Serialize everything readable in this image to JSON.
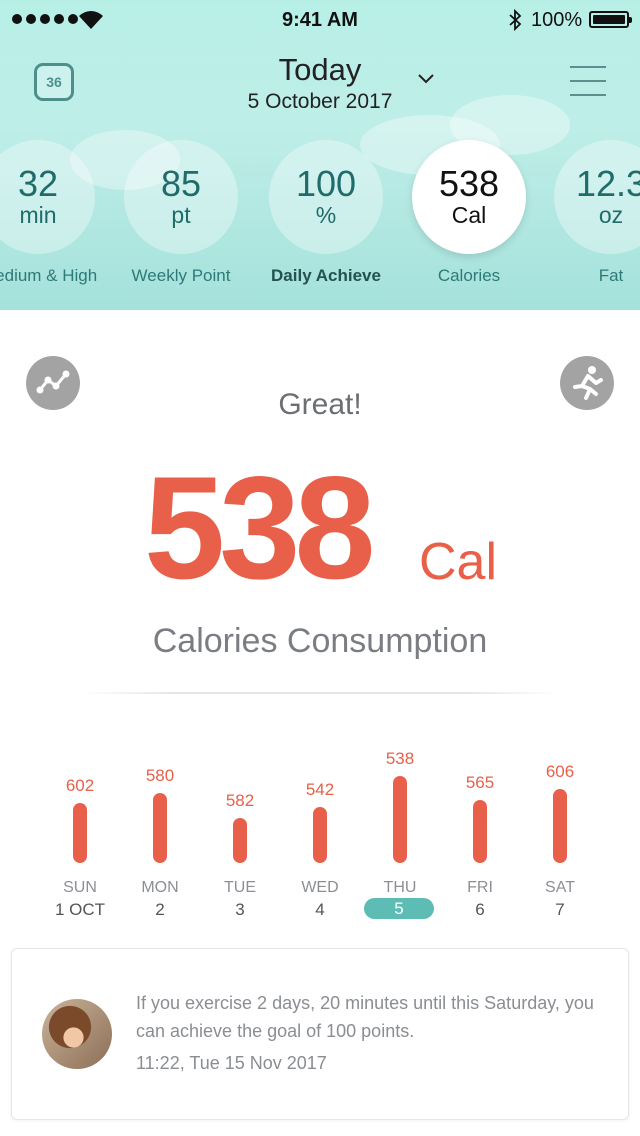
{
  "status_bar": {
    "time": "9:41 AM",
    "battery": "100%"
  },
  "header": {
    "badge": "36",
    "title": "Today",
    "date": "5 October 2017"
  },
  "metrics": [
    {
      "value": "32",
      "unit": "min",
      "label": "Medium & High"
    },
    {
      "value": "85",
      "unit": "pt",
      "label": "Weekly Point"
    },
    {
      "value": "100",
      "unit": "%",
      "label": "Daily Achieve"
    },
    {
      "value": "538",
      "unit": "Cal",
      "label": "Calories"
    },
    {
      "value": "12.3",
      "unit": "oz",
      "label": "Fat"
    }
  ],
  "summary": {
    "rating": "Great!",
    "value": "538",
    "unit": "Cal",
    "caption": "Calories Consumption"
  },
  "chart_data": {
    "type": "bar",
    "categories": [
      "SUN 1 OCT",
      "MON 2",
      "TUE 3",
      "WED 4",
      "THU 5",
      "FRI 6",
      "SAT 7"
    ],
    "values": [
      602,
      580,
      582,
      542,
      538,
      565,
      606
    ],
    "days": [
      {
        "name": "SUN",
        "date": "1 OCT",
        "value": "602"
      },
      {
        "name": "MON",
        "date": "2",
        "value": "580"
      },
      {
        "name": "TUE",
        "date": "3",
        "value": "582"
      },
      {
        "name": "WED",
        "date": "4",
        "value": "542"
      },
      {
        "name": "THU",
        "date": "5",
        "value": "538"
      },
      {
        "name": "FRI",
        "date": "6",
        "value": "565"
      },
      {
        "name": "SAT",
        "date": "7",
        "value": "606"
      }
    ],
    "selected_index": 4,
    "bar_color": "#e8604a"
  },
  "notification": {
    "message": "If you exercise 2 days, 20 minutes until this Saturday, you can achieve the goal of 100 points.",
    "timestamp": "11:22, Tue 15 Nov 2017"
  },
  "colors": {
    "accent": "#e8604a",
    "teal": "#5dbcb3",
    "header_bg": "#b7efe7"
  },
  "icons": {
    "left_button": "trend-line-icon",
    "right_button": "running-person-icon"
  }
}
